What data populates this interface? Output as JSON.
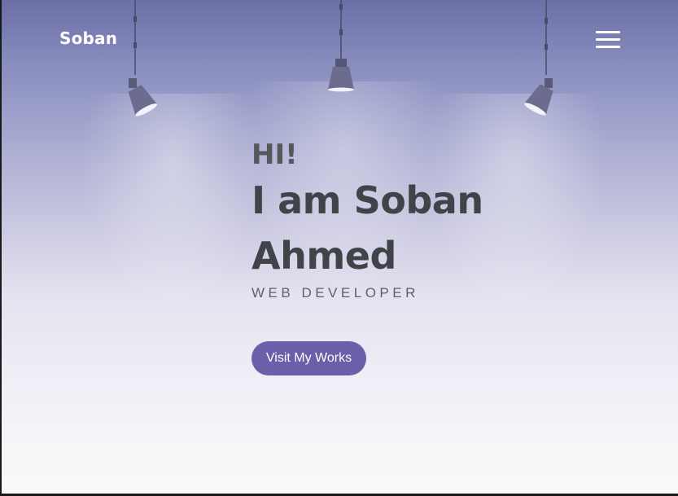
{
  "header": {
    "brand": "Soban",
    "menu_icon": "hamburger-menu-icon"
  },
  "hero": {
    "greeting": "HI!",
    "name": "I am Soban Ahmed",
    "role": "WEB DEVELOPER",
    "cta_label": "Visit My Works"
  },
  "decorations": {
    "lamps": [
      "spotlight-lamp-icon",
      "spotlight-lamp-icon",
      "spotlight-lamp-icon"
    ]
  },
  "colors": {
    "accent": "#6a5fa8",
    "heading": "#404448",
    "brand_text": "#ffffff"
  }
}
